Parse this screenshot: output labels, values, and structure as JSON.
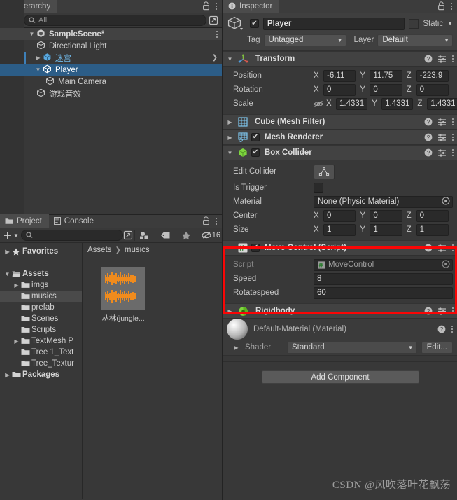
{
  "hierarchy": {
    "tab_label": "Hierarchy",
    "search_placeholder": "All",
    "add_label": "+",
    "rows": [
      {
        "label": "SampleScene*",
        "kind": "scene",
        "arrow": "▼",
        "depth": 0
      },
      {
        "label": "Directional Light",
        "kind": "object",
        "arrow": "",
        "depth": 1
      },
      {
        "label": "迷宫",
        "kind": "object-blue",
        "arrow": "▶",
        "depth": 1
      },
      {
        "label": "Player",
        "kind": "selected",
        "arrow": "▼",
        "depth": 1
      },
      {
        "label": "Main Camera",
        "kind": "object",
        "arrow": "",
        "depth": 2
      },
      {
        "label": "游戏音效",
        "kind": "object",
        "arrow": "",
        "depth": 1
      }
    ]
  },
  "project": {
    "tabs": [
      {
        "label": "Project",
        "active": true,
        "icon": "folder-icon"
      },
      {
        "label": "Console",
        "active": false,
        "icon": "console-icon"
      }
    ],
    "search_placeholder": "",
    "hidden_count": "16",
    "tree": [
      {
        "label": "Favorites",
        "arrow": "▶",
        "depth": 0,
        "bold": true,
        "icon": "star-icon",
        "selected": false
      },
      {
        "label": "",
        "arrow": "",
        "depth": 0,
        "spacer": true,
        "icon": "",
        "selected": false
      },
      {
        "label": "Assets",
        "arrow": "▼",
        "depth": 0,
        "bold": true,
        "icon": "open-folder-icon",
        "selected": false
      },
      {
        "label": "imgs",
        "arrow": "▶",
        "depth": 1,
        "bold": false,
        "icon": "folder-icon",
        "selected": false
      },
      {
        "label": "musics",
        "arrow": "",
        "depth": 1,
        "bold": false,
        "icon": "folder-icon",
        "selected": true
      },
      {
        "label": "prefab",
        "arrow": "",
        "depth": 1,
        "bold": false,
        "icon": "folder-icon",
        "selected": false
      },
      {
        "label": "Scenes",
        "arrow": "",
        "depth": 1,
        "bold": false,
        "icon": "folder-icon",
        "selected": false
      },
      {
        "label": "Scripts",
        "arrow": "",
        "depth": 1,
        "bold": false,
        "icon": "folder-icon",
        "selected": false
      },
      {
        "label": "TextMesh P",
        "arrow": "▶",
        "depth": 1,
        "bold": false,
        "icon": "folder-icon",
        "selected": false
      },
      {
        "label": "Tree 1_Text",
        "arrow": "",
        "depth": 1,
        "bold": false,
        "icon": "folder-icon",
        "selected": false
      },
      {
        "label": "Tree_Textur",
        "arrow": "",
        "depth": 1,
        "bold": false,
        "icon": "folder-icon",
        "selected": false
      },
      {
        "label": "Packages",
        "arrow": "▶",
        "depth": 0,
        "bold": true,
        "icon": "folder-icon",
        "selected": false
      }
    ],
    "breadcrumb": [
      "Assets",
      "musics"
    ],
    "breadcrumb_sep": "❯",
    "assets": [
      {
        "label": "丛林(jungle...",
        "type": "audio-clip"
      }
    ]
  },
  "inspector": {
    "tab_label": "Inspector",
    "object": {
      "enabled": true,
      "name": "Player",
      "static_label": "Static",
      "static_checked": false,
      "tag_label": "Tag",
      "tag_value": "Untagged",
      "layer_label": "Layer",
      "layer_value": "Default"
    },
    "transform": {
      "title": "Transform",
      "arrow": "▼",
      "position_label": "Position",
      "position": {
        "x": "-6.11",
        "y": "11.75",
        "z": "-223.9"
      },
      "rotation_label": "Rotation",
      "rotation": {
        "x": "0",
        "y": "0",
        "z": "0"
      },
      "scale_label": "Scale",
      "scale": {
        "x": "1.4331",
        "y": "1.4331",
        "z": "1.4331"
      }
    },
    "mesh_filter": {
      "title": "Cube (Mesh Filter)",
      "arrow": "▶"
    },
    "mesh_renderer": {
      "title": "Mesh Renderer",
      "arrow": "▶",
      "enabled": true
    },
    "box_collider": {
      "title": "Box Collider",
      "arrow": "▼",
      "enabled": true,
      "edit_collider_label": "Edit Collider",
      "is_trigger_label": "Is Trigger",
      "is_trigger_checked": false,
      "material_label": "Material",
      "material_value": "None (Physic Material)",
      "center_label": "Center",
      "center": {
        "x": "0",
        "y": "0",
        "z": "0"
      },
      "size_label": "Size",
      "size": {
        "x": "1",
        "y": "1",
        "z": "1"
      }
    },
    "move_control": {
      "title": "Move Control (Script)",
      "arrow": "▼",
      "enabled": true,
      "script_label": "Script",
      "script_value": "MoveControl",
      "speed_label": "Speed",
      "speed_value": "8",
      "rotatespeed_label": "Rotatespeed",
      "rotatespeed_value": "60",
      "highlight_color": "#f90606"
    },
    "rigidbody": {
      "title": "Rigidbody",
      "arrow": "▶"
    },
    "material": {
      "title": "Default-Material (Material)",
      "shader_label": "Shader",
      "shader_value": "Standard",
      "edit_label": "Edit...",
      "arrow": "▶"
    },
    "add_component_label": "Add Component"
  },
  "watermark": "CSDN @风吹落叶花飘荡",
  "colors": {
    "panel_bg": "#383838",
    "header_bg": "#3f3f3f",
    "comp_header_bg": "#424242",
    "selection_blue": "#2c5d87",
    "field_bg": "#2a2a2a",
    "accent_red": "#f90606",
    "text": "#c4c4c4"
  }
}
